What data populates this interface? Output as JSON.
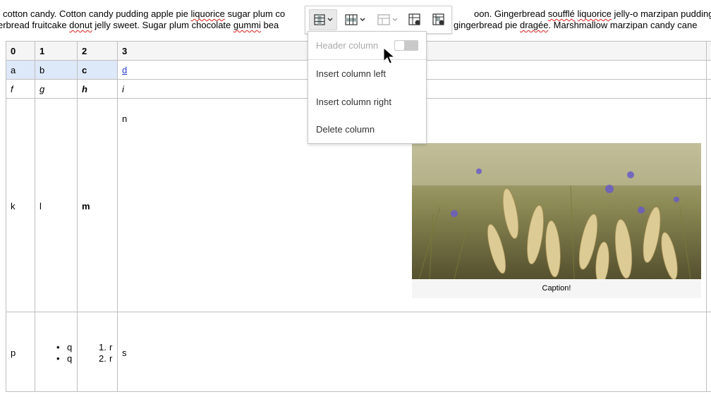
{
  "paragraph": {
    "line1_a": "cotton candy. Cotton candy pudding apple pie ",
    "line1_sp1": "liquorice",
    "line1_b": " sugar plum co",
    "line1_right_a": "oon. Gingerbread ",
    "line1_right_sp1": "soufflé",
    "line1_right_b": " ",
    "line1_right_sp2": "liquorice",
    "line1_right_c": " jelly-o marzipan pudding",
    "line2_a": "erbread fruitcake ",
    "line2_sp1": "donut",
    "line2_b": " jelly sweet. Sugar plum chocolate ",
    "line2_sp2": "gummi",
    "line2_c": " bea",
    "line2_right_a": "gingerbread pie ",
    "line2_right_sp1": "dragée",
    "line2_right_b": ". Marshmallow marzipan candy cane"
  },
  "table": {
    "header": [
      "0",
      "1",
      "2",
      "3"
    ],
    "row1": [
      "a",
      "b",
      "c",
      "d"
    ],
    "row2": [
      "f",
      "g",
      "h",
      "i"
    ],
    "row3": {
      "c0": "k",
      "c1": "l",
      "c2": "m",
      "c3": "n"
    },
    "row4": {
      "c0": "p",
      "list_bullets": [
        "q",
        "q"
      ],
      "list_numbers": [
        "1.",
        "2."
      ],
      "list_items": [
        "r",
        "r"
      ],
      "c3": "s"
    },
    "figure_caption": "Caption!"
  },
  "toolbar": {
    "buttons": [
      "column-menu",
      "row-menu",
      "merge-cells-menu",
      "table-properties",
      "cell-properties"
    ]
  },
  "column_menu": {
    "header_column_label": "Header column",
    "header_column_on": false,
    "insert_left": "Insert column left",
    "insert_right": "Insert column right",
    "delete": "Delete column"
  },
  "colors": {
    "selected_cell": "#dde8f8",
    "link": "#2a3fd0",
    "spell_error": "#e02020"
  }
}
